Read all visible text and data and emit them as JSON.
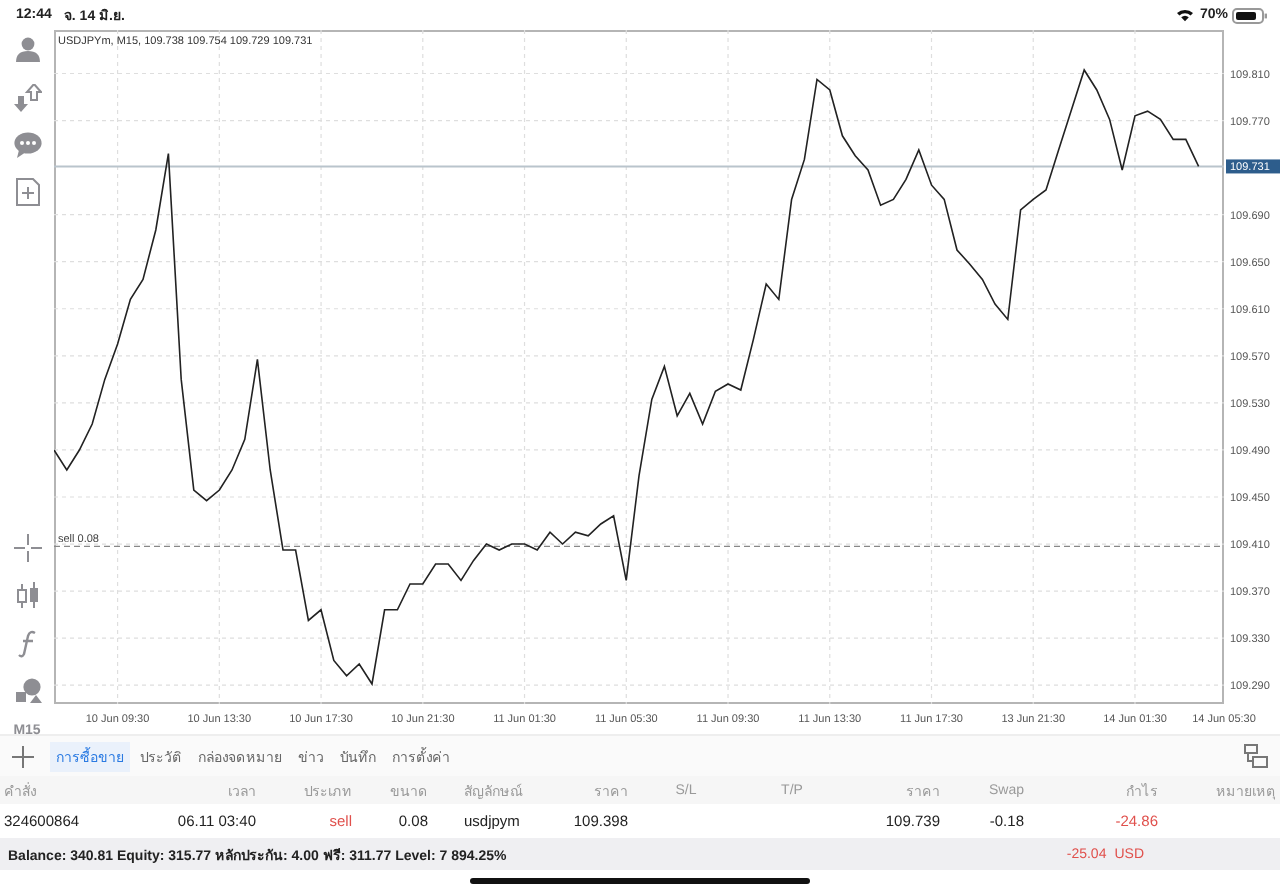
{
  "status_bar": {
    "time": "12:44",
    "date": "จ. 14 มิ.ย.",
    "battery_text": "70%"
  },
  "toolbar": {
    "timeframe": "M15"
  },
  "chart": {
    "chart_data": {
      "type": "line",
      "title": "USDJPYm, M15, 109.738 109.754 109.729 109.731",
      "categories": [
        null,
        null,
        null,
        null,
        null,
        "10 Jun 09:30",
        null,
        null,
        null,
        null,
        null,
        null,
        null,
        "10 Jun 13:30",
        null,
        null,
        null,
        null,
        null,
        null,
        null,
        "10 Jun 17:30",
        null,
        null,
        null,
        null,
        null,
        null,
        null,
        "10 Jun 21:30",
        null,
        null,
        null,
        null,
        null,
        null,
        null,
        "11 Jun 01:30",
        null,
        null,
        null,
        null,
        null,
        null,
        null,
        "11 Jun 05:30",
        null,
        null,
        null,
        null,
        null,
        null,
        null,
        "11 Jun 09:30",
        null,
        null,
        null,
        null,
        null,
        null,
        null,
        "11 Jun 13:30",
        null,
        null,
        null,
        null,
        null,
        null,
        null,
        "11 Jun 17:30",
        null,
        null,
        null,
        null,
        null,
        null,
        null,
        "13 Jun 21:30",
        null,
        null,
        null,
        null,
        null,
        null,
        null,
        "14 Jun 01:30",
        null,
        null,
        null,
        null,
        null,
        null,
        "14 Jun 05:30"
      ],
      "ylim": [
        109.274,
        109.847
      ],
      "grid": true,
      "series": [
        {
          "color": "#222222",
          "values": [
            109.49,
            109.473,
            109.49,
            109.512,
            109.55,
            109.58,
            109.618,
            109.635,
            109.677,
            109.742,
            109.55,
            109.456,
            109.447,
            109.456,
            109.473,
            109.499,
            109.567,
            109.473,
            109.405,
            109.405,
            109.345,
            109.354,
            109.311,
            109.298,
            109.308,
            109.291,
            109.354,
            109.354,
            109.376,
            109.376,
            109.393,
            109.393,
            109.379,
            109.396,
            109.41,
            109.405,
            109.41,
            109.41,
            109.405,
            109.42,
            109.41,
            109.42,
            109.417,
            109.427,
            109.434,
            109.379,
            109.468,
            109.533,
            109.561,
            109.519,
            109.538,
            109.512,
            109.54,
            109.546,
            109.541,
            109.584,
            109.631,
            109.618,
            109.703,
            109.737,
            109.805,
            109.796,
            109.757,
            109.74,
            109.728,
            109.698,
            109.703,
            109.72,
            109.745,
            109.715,
            109.703,
            109.66,
            109.648,
            109.635,
            109.614,
            109.601,
            109.694,
            109.703,
            109.711,
            109.745,
            109.779,
            109.813,
            109.796,
            109.771,
            109.728,
            109.774,
            109.778,
            109.771,
            109.754,
            109.754,
            109.731,
            null,
            null
          ]
        }
      ],
      "yticks": [
        {
          "value": 109.29,
          "label": "109.290"
        },
        {
          "value": 109.33,
          "label": "109.330"
        },
        {
          "value": 109.37,
          "label": "109.370"
        },
        {
          "value": 109.41,
          "label": "109.410"
        },
        {
          "value": 109.45,
          "label": "109.450"
        },
        {
          "value": 109.49,
          "label": "109.490"
        },
        {
          "value": 109.53,
          "label": "109.530"
        },
        {
          "value": 109.57,
          "label": "109.570"
        },
        {
          "value": 109.61,
          "label": "109.610"
        },
        {
          "value": 109.65,
          "label": "109.650"
        },
        {
          "value": 109.69,
          "label": "109.690"
        },
        {
          "value": 109.77,
          "label": "109.770"
        },
        {
          "value": 109.81,
          "label": "109.810"
        }
      ],
      "ref_lines": [
        {
          "axis": "y",
          "value": 109.731,
          "label": "109.731"
        },
        {
          "axis": "y",
          "value": 109.408,
          "label": "sell 0.08"
        }
      ]
    }
  },
  "tabs": [
    {
      "label": "การซื้อขาย",
      "selected": true
    },
    {
      "label": "ประวัติ",
      "selected": false
    },
    {
      "label": "กล่องจดหมาย",
      "selected": false
    },
    {
      "label": "ข่าว",
      "selected": false
    },
    {
      "label": "บันทึก",
      "selected": false
    },
    {
      "label": "การตั้งค่า",
      "selected": false
    }
  ],
  "table": {
    "columns": [
      "คำสั่ง",
      "เวลา",
      "ประเภท",
      "ขนาด",
      "สัญลักษณ์",
      "ราคา",
      "S/L",
      "T/P",
      "ราคา",
      "Swap",
      "กำไร",
      "หมายเหตุ"
    ],
    "rows": [
      {
        "cells": [
          {
            "text": "324600864"
          },
          {
            "text": "06.11 03:40"
          },
          {
            "text": "sell",
            "color": "#e0504c"
          },
          {
            "text": "0.08"
          },
          {
            "text": "usdjpym"
          },
          {
            "text": "109.398"
          },
          {
            "text": ""
          },
          {
            "text": ""
          },
          {
            "text": "109.739"
          },
          {
            "text": "-0.18"
          },
          {
            "text": "-24.86",
            "color": "#e0504c"
          },
          {
            "text": ""
          }
        ]
      }
    ]
  },
  "summary": {
    "text": "Balance: 340.81 Equity: 315.77 หลักประกัน: 4.00 ฟรี: 311.77 Level: 7 894.25%",
    "total": "-25.04",
    "currency": "USD",
    "color": "#e0504c"
  }
}
